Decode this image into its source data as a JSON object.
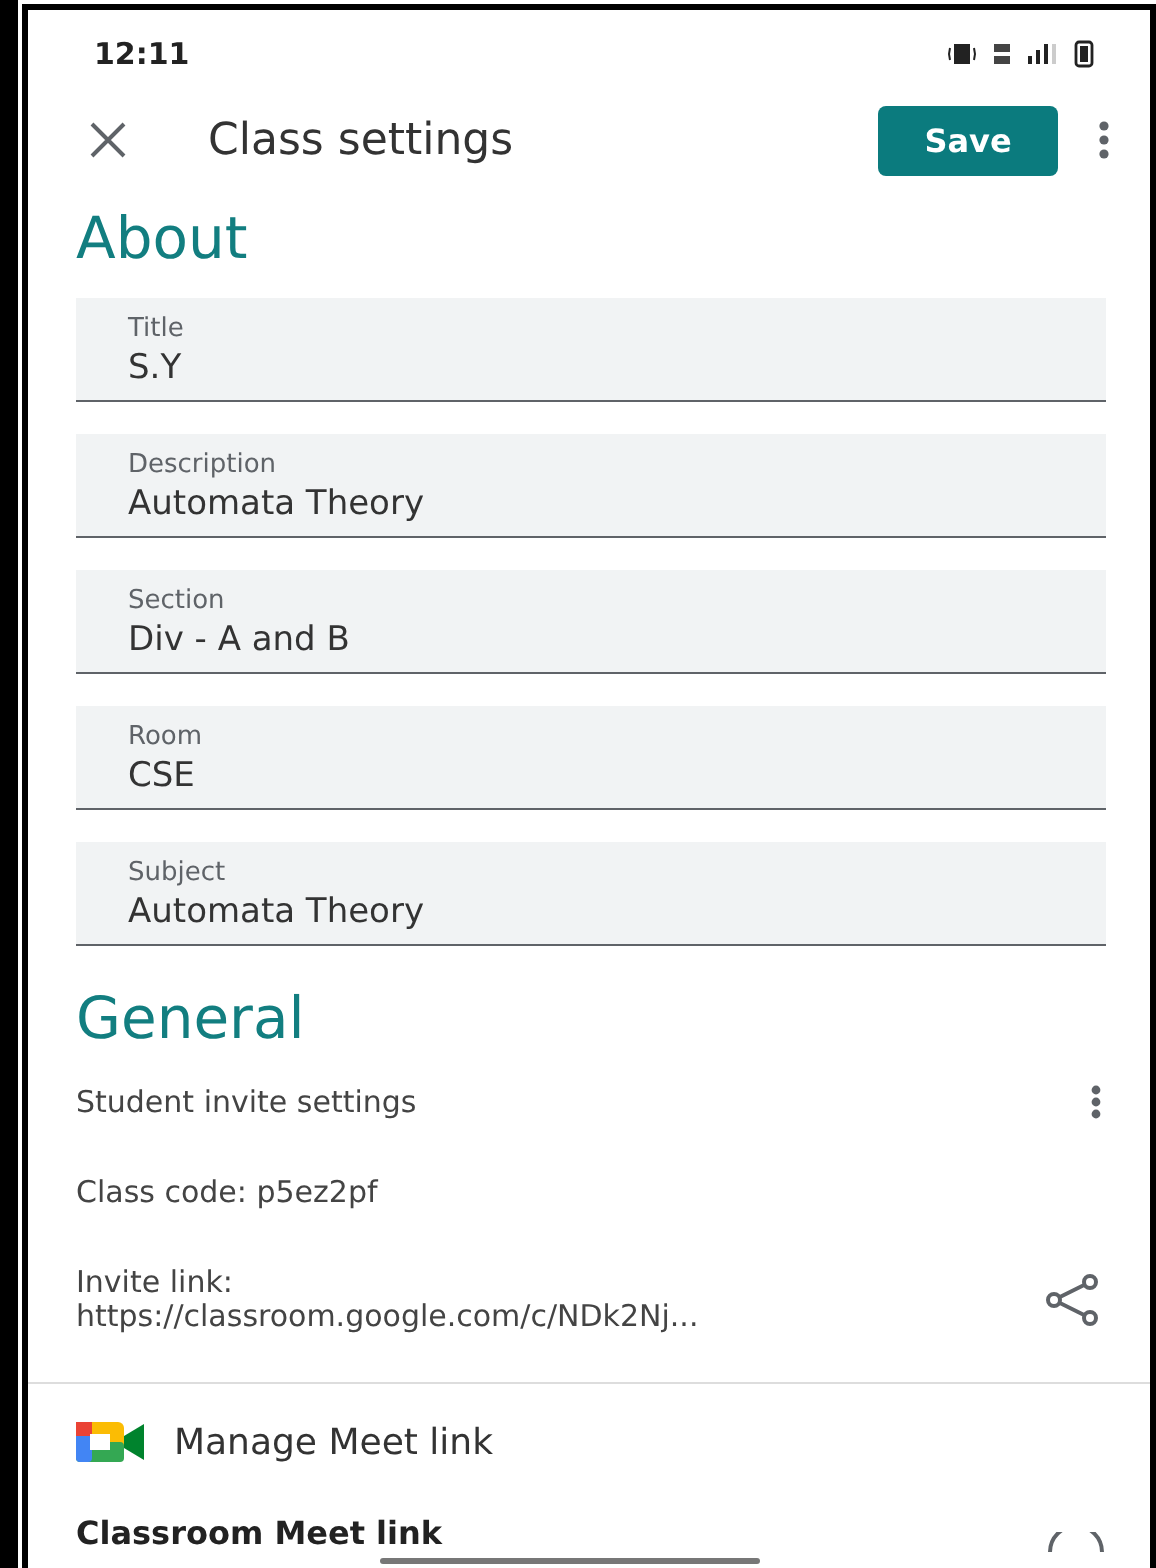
{
  "status_bar": {
    "time": "12:11"
  },
  "app_bar": {
    "title": "Class settings",
    "save_label": "Save"
  },
  "about": {
    "heading": "About",
    "fields": [
      {
        "label": "Title",
        "value": "S.Y"
      },
      {
        "label": "Description",
        "value": "Automata Theory"
      },
      {
        "label": "Section",
        "value": "Div - A and B"
      },
      {
        "label": "Room",
        "value": "CSE"
      },
      {
        "label": "Subject",
        "value": "Automata Theory"
      }
    ]
  },
  "general": {
    "heading": "General",
    "student_invite": "Student invite settings",
    "class_code": "Class code: p5ez2pf",
    "invite_label": "Invite link:",
    "invite_url": "https://classroom.google.com/c/NDk2Nj..."
  },
  "meet": {
    "title": "Manage Meet link",
    "subtitle": "Classroom Meet link"
  }
}
